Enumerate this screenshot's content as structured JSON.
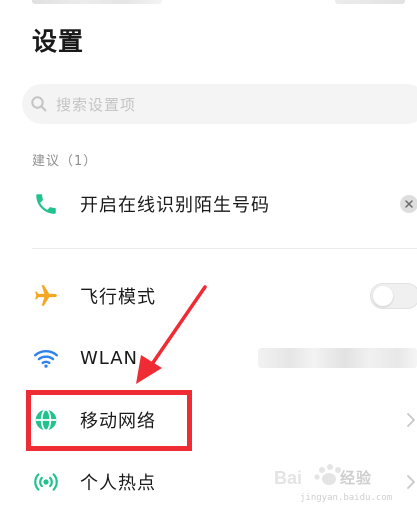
{
  "page": {
    "title": "设置"
  },
  "search": {
    "placeholder": "搜索设置项",
    "icon": "search-icon"
  },
  "suggestions": {
    "header": "建议（1）",
    "items": [
      {
        "label": "开启在线识别陌生号码",
        "icon": "phone-icon",
        "icon_color": "#21c28e",
        "action": "dismiss"
      }
    ]
  },
  "settings": {
    "items": [
      {
        "label": "飞行模式",
        "icon": "airplane-icon",
        "icon_color": "#f5a623",
        "control": "toggle",
        "toggle_on": false
      },
      {
        "label": "WLAN",
        "icon": "wifi-icon",
        "icon_color": "#2f80ed",
        "control": "value"
      },
      {
        "label": "移动网络",
        "icon": "globe-icon",
        "icon_color": "#21c28e",
        "control": "chevron",
        "highlighted": true
      },
      {
        "label": "个人热点",
        "icon": "hotspot-icon",
        "icon_color": "#21c28e",
        "control": "chevron"
      }
    ]
  },
  "annotation": {
    "highlight_color": "#ef2b33"
  },
  "watermark": {
    "text": "Bai 经验",
    "url": "jingyan.baidu.com"
  }
}
